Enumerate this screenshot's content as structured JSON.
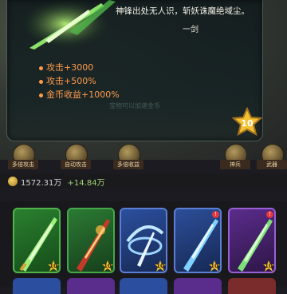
{
  "weapon": {
    "quote": "神锋出处无人识，斩妖诛魔绝域尘。",
    "author": "一剑",
    "stats": [
      "攻击+3000",
      "攻击+500%",
      "金币收益+1000%"
    ],
    "faded_text": "宝物可以加速金币",
    "star_level": "10"
  },
  "toolbar": {
    "items": [
      "多倍攻击",
      "自动攻击",
      "多倍收益",
      "神兵",
      "武器"
    ]
  },
  "resources": {
    "gold_text": "1572.31万",
    "rate_text": "+14.84万"
  },
  "inventory": {
    "items": [
      {
        "name": "emerald-sword",
        "level": "10",
        "color": "#2e8b3a"
      },
      {
        "name": "red-sword",
        "level": "10",
        "color": "#2e7d34"
      },
      {
        "name": "wind-blade",
        "level": "10",
        "color": "#2d4f9b"
      },
      {
        "name": "ice-sword",
        "level": "10",
        "color": "#2d4f9b"
      },
      {
        "name": "purple-sword",
        "level": "10",
        "color": "#5b2d8a"
      }
    ]
  }
}
